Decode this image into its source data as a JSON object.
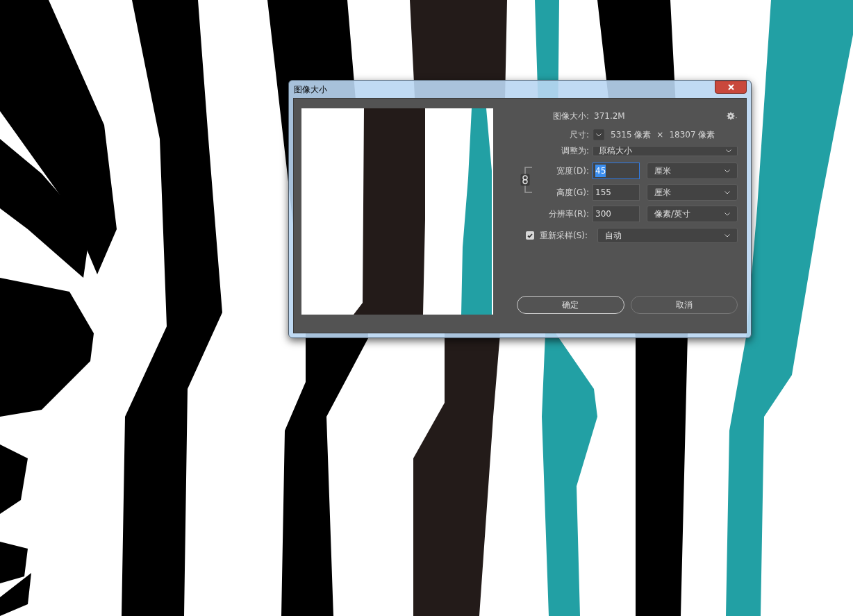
{
  "window": {
    "title": "图像大小"
  },
  "image_size": {
    "label": "图像大小:",
    "value": "371.2M"
  },
  "dimensions": {
    "label": "尺寸:",
    "width": "5315 像素",
    "separator": "×",
    "height": "18307 像素"
  },
  "fit_to": {
    "label": "调整为:",
    "value": "原稿大小"
  },
  "linked": true,
  "fields": [
    {
      "label": "宽度(D):",
      "value": "45",
      "unit": "厘米",
      "focused": true
    },
    {
      "label": "高度(G):",
      "value": "155",
      "unit": "厘米",
      "focused": false
    },
    {
      "label": "分辨率(R):",
      "value": "300",
      "unit": "像素/英寸",
      "focused": false
    }
  ],
  "resample": {
    "label": "重新采样(S):",
    "checked": true,
    "value": "自动"
  },
  "buttons": [
    {
      "label": "确定",
      "default": true
    },
    {
      "label": "取消",
      "default": false
    }
  ]
}
